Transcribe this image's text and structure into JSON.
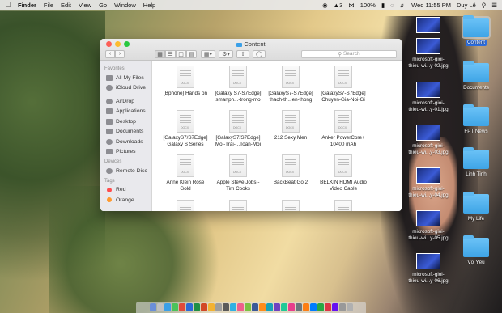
{
  "menubar": {
    "app": "Finder",
    "menus": [
      "File",
      "Edit",
      "View",
      "Go",
      "Window",
      "Help"
    ],
    "status": {
      "notif": "3",
      "battery": "100%",
      "clock": "Wed 11:55 PM",
      "user": "Duy Lê"
    }
  },
  "window": {
    "title": "Content",
    "search_placeholder": "Search",
    "sidebar": {
      "favorites_head": "Favorites",
      "favorites": [
        "All My Files",
        "iCloud Drive",
        "AirDrop",
        "Applications",
        "Desktop",
        "Documents",
        "Downloads",
        "Pictures"
      ],
      "devices_head": "Devices",
      "devices": [
        "Remote Disc"
      ],
      "tags_head": "Tags",
      "tags": [
        {
          "label": "Red",
          "color": "#ff4d4d"
        },
        {
          "label": "Orange",
          "color": "#ff9a2e"
        }
      ]
    },
    "files": [
      {
        "l1": "[Bphone] Hands on",
        "l2": ""
      },
      {
        "l1": "[Galaxy S7-S7Edge]",
        "l2": "smartph...-trong-mo"
      },
      {
        "l1": "[GalaxyS7-S7Edge]",
        "l2": "thach-th...en-thong"
      },
      {
        "l1": "[GalaxyS7-S7Edge]",
        "l2": "Chuyen-Gia-Noi-Gi"
      },
      {
        "l1": "[GalaxyS7/S7Edge]",
        "l2": "Galaxy S Series"
      },
      {
        "l1": "[GalaxyS7/S7Edge]",
        "l2": "Moi-Trai-...Toan-Moi"
      },
      {
        "l1": "212 Sexy Men",
        "l2": ""
      },
      {
        "l1": "Anker PowerCore+",
        "l2": "10400 mAh"
      },
      {
        "l1": "Anne Klein Rose",
        "l2": "Gold"
      },
      {
        "l1": "Apple Steve Jobs -",
        "l2": "Tim Cooks"
      },
      {
        "l1": "BackBeat Go 2",
        "l2": ""
      },
      {
        "l1": "BELKIN HDMI Audio",
        "l2": "Video Cable"
      }
    ],
    "doc_tag": "DOCX"
  },
  "desktop": {
    "right_col": [
      {
        "label": "Content",
        "kind": "folder",
        "selected": true
      },
      {
        "label": "Documents",
        "kind": "folder"
      },
      {
        "label": "FPT News",
        "kind": "folder"
      },
      {
        "label": "Linh Tinh",
        "kind": "folder"
      },
      {
        "label": "My Life",
        "kind": "folder"
      },
      {
        "label": "Vợ Yêu",
        "kind": "folder"
      }
    ],
    "left_col": [
      {
        "l1": "",
        "l2": ""
      },
      {
        "l1": "microsoft-gioi-",
        "l2": "thieu-wi...y-02.jpg"
      },
      {
        "l1": "microsoft-gioi-",
        "l2": "thieu-wi...y-01.jpg"
      },
      {
        "l1": "microsoft-gioi-",
        "l2": "thieu-wi...y-03.jpg"
      },
      {
        "l1": "microsoft-gioi-",
        "l2": "thieu-wi...y-04.jpg"
      },
      {
        "l1": "microsoft-gioi-",
        "l2": "thieu-wi...y-05.jpg"
      },
      {
        "l1": "microsoft-gioi-",
        "l2": "thieu-wi...y-06.jpg"
      }
    ]
  }
}
